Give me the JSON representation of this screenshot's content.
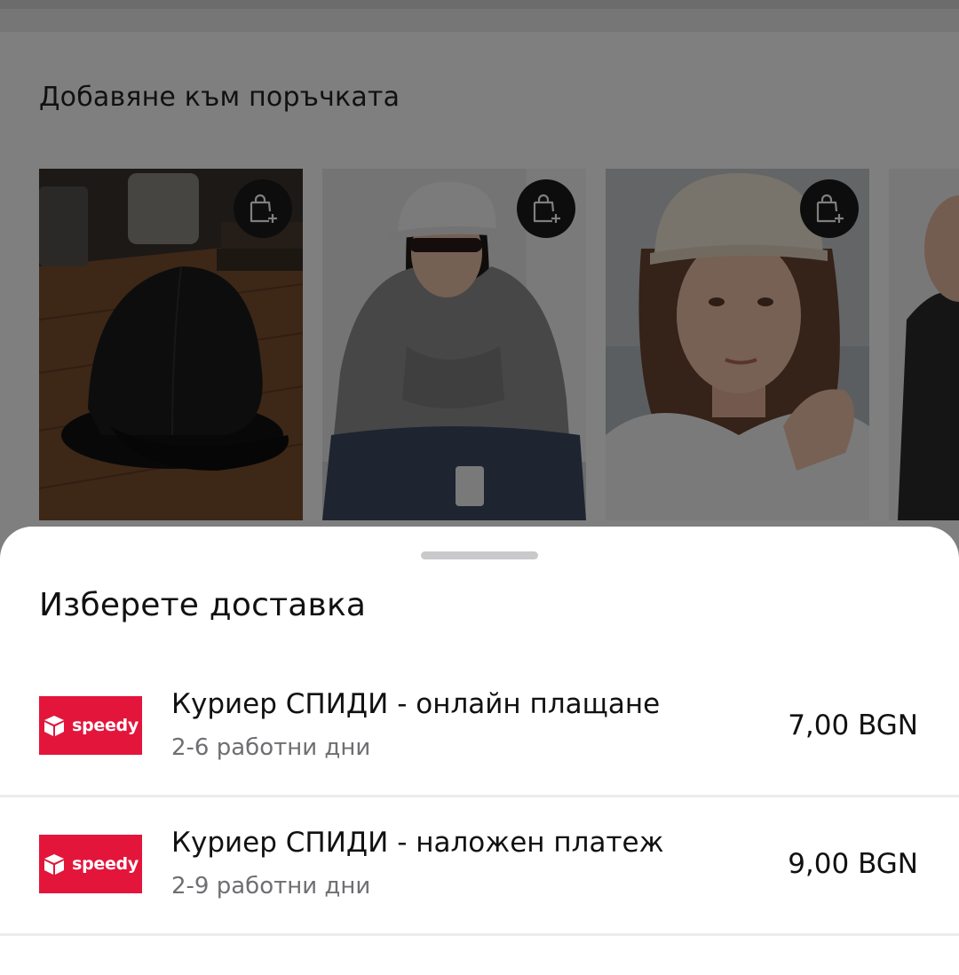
{
  "background": {
    "section_title": "Добавяне към поръчката",
    "products": [
      {
        "name": "product-black-cap",
        "add_icon": "add-to-bag-icon"
      },
      {
        "name": "product-white-cap-hoodie",
        "add_icon": "add-to-bag-icon"
      },
      {
        "name": "product-beige-cap",
        "add_icon": "add-to-bag-icon"
      },
      {
        "name": "product-partial",
        "add_icon": "add-to-bag-icon"
      }
    ]
  },
  "sheet": {
    "title": "Изберете доставка",
    "options": [
      {
        "logo_text": "speedy",
        "name": "Куриер СПИДИ - онлайн плащане",
        "eta": "2-6 работни дни",
        "price": "7,00 BGN"
      },
      {
        "logo_text": "speedy",
        "name": "Куриер СПИДИ - наложен платеж",
        "eta": "2-9 работни дни",
        "price": "9,00 BGN"
      }
    ]
  },
  "colors": {
    "speedy_red": "#e3153b",
    "overlay": "rgba(0,0,0,0.5)",
    "text_primary": "#111111",
    "text_secondary": "#6f6f73"
  }
}
